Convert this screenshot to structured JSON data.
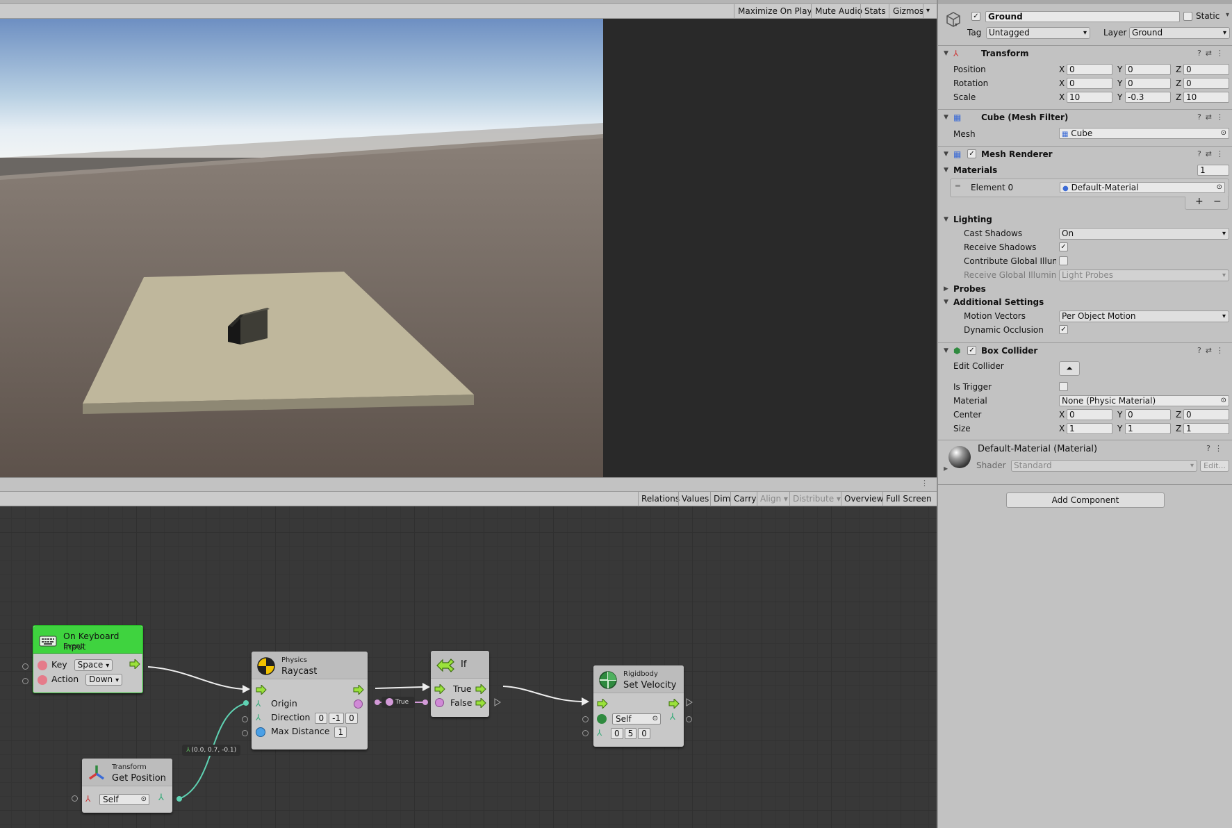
{
  "game_toolbar": {
    "items": [
      "Maximize On Play",
      "Mute Audio",
      "Stats",
      "Gizmos"
    ]
  },
  "graph_toolbar": {
    "items": [
      "Relations",
      "Values",
      "Dim",
      "Carry",
      "Align",
      "Distribute",
      "Overview",
      "Full Screen"
    ]
  },
  "nodes": {
    "keyboard": {
      "title": "On Keyboard Input",
      "subtitle": "Event",
      "key_label": "Key",
      "key_value": "Space",
      "action_label": "Action",
      "action_value": "Down"
    },
    "raycast": {
      "category": "Physics",
      "title": "Raycast",
      "origin_label": "Origin",
      "direction_label": "Direction",
      "direction_values": [
        "0",
        "-1",
        "0"
      ],
      "max_distance_label": "Max Distance",
      "max_distance_value": "1"
    },
    "if": {
      "title": "If",
      "true_label": "True",
      "false_label": "False",
      "edge_tag": "True"
    },
    "set_velocity": {
      "category": "Rigidbody",
      "title": "Set Velocity",
      "target_value": "Self",
      "velocity_values": [
        "0",
        "5",
        "0"
      ]
    },
    "get_position": {
      "category": "Transform",
      "title": "Get Position",
      "target_value": "Self",
      "edge_value": "(0.0, 0.7, -0.1)"
    }
  },
  "inspector": {
    "object_name": "Ground",
    "static_label": "Static",
    "tag_label": "Tag",
    "tag_value": "Untagged",
    "layer_label": "Layer",
    "layer_value": "Ground",
    "transform": {
      "title": "Transform",
      "position_label": "Position",
      "position": [
        "0",
        "0",
        "0"
      ],
      "rotation_label": "Rotation",
      "rotation": [
        "0",
        "0",
        "0"
      ],
      "scale_label": "Scale",
      "scale": [
        "10",
        "-0.3",
        "10"
      ]
    },
    "mesh_filter": {
      "title": "Cube (Mesh Filter)",
      "mesh_label": "Mesh",
      "mesh_value": "Cube"
    },
    "mesh_renderer": {
      "title": "Mesh Renderer",
      "materials_label": "Materials",
      "materials_count": "1",
      "element0_label": "Element 0",
      "element0_value": "Default-Material",
      "lighting_label": "Lighting",
      "cast_shadows_label": "Cast Shadows",
      "cast_shadows_value": "On",
      "receive_shadows_label": "Receive Shadows",
      "contribute_gi_label": "Contribute Global Illumin",
      "receive_gi_label": "Receive Global Illuminat",
      "receive_gi_value": "Light Probes",
      "probes_label": "Probes",
      "additional_label": "Additional Settings",
      "motion_vectors_label": "Motion Vectors",
      "motion_vectors_value": "Per Object Motion",
      "dynamic_occlusion_label": "Dynamic Occlusion"
    },
    "box_collider": {
      "title": "Box Collider",
      "edit_collider_label": "Edit Collider",
      "is_trigger_label": "Is Trigger",
      "material_label": "Material",
      "material_value": "None (Physic Material)",
      "center_label": "Center",
      "center": [
        "0",
        "0",
        "0"
      ],
      "size_label": "Size",
      "size": [
        "1",
        "1",
        "1"
      ]
    },
    "material": {
      "title": "Default-Material (Material)",
      "shader_label": "Shader",
      "shader_value": "Standard",
      "edit_label": "Edit..."
    },
    "add_component_label": "Add Component"
  }
}
